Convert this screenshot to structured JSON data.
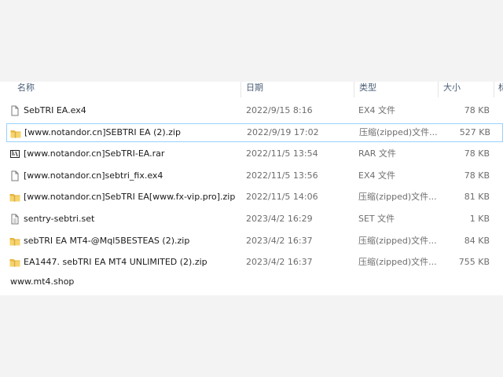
{
  "columns": {
    "name": "名称",
    "date": "日期",
    "type": "类型",
    "size": "大小",
    "extra": "标"
  },
  "files": [
    {
      "name": "SebTRI EA.ex4",
      "date": "2022/9/15 8:16",
      "type": "EX4 文件",
      "size": "78 KB",
      "icon": "file-icon"
    },
    {
      "name": "[www.notandor.cn]SEBTRI EA (2).zip",
      "date": "2022/9/19 17:02",
      "type": "压缩(zipped)文件...",
      "size": "527 KB",
      "icon": "zip-folder-icon"
    },
    {
      "name": "[www.notandor.cn]SebTRI-EA.rar",
      "date": "2022/11/5 13:54",
      "type": "RAR 文件",
      "size": "78 KB",
      "icon": "rar-icon"
    },
    {
      "name": "[www.notandor.cn]sebtri_fix.ex4",
      "date": "2022/11/5 13:56",
      "type": "EX4 文件",
      "size": "78 KB",
      "icon": "file-icon"
    },
    {
      "name": "[www.notandor.cn]SebTRI EA[www.fx-vip.pro].zip",
      "date": "2022/11/5 14:06",
      "type": "压缩(zipped)文件...",
      "size": "81 KB",
      "icon": "zip-folder-icon"
    },
    {
      "name": "sentry-sebtri.set",
      "date": "2023/4/2 16:29",
      "type": "SET 文件",
      "size": "1 KB",
      "icon": "text-file-icon"
    },
    {
      "name": "sebTRI EA MT4-@Mql5BESTEAS (2).zip",
      "date": "2023/4/2 16:37",
      "type": "压缩(zipped)文件...",
      "size": "84 KB",
      "icon": "zip-folder-icon"
    },
    {
      "name": "EA1447. sebTRI EA MT4 UNLIMITED (2).zip",
      "date": "2023/4/2 16:37",
      "type": "压缩(zipped)文件...",
      "size": "755 KB",
      "icon": "zip-folder-icon"
    }
  ],
  "selected_index": 1,
  "footer": "www.mt4.shop",
  "colors": {
    "selection_border": "#99d1ff",
    "header_text": "#4c6078",
    "folder_yellow": "#f2c94c"
  }
}
